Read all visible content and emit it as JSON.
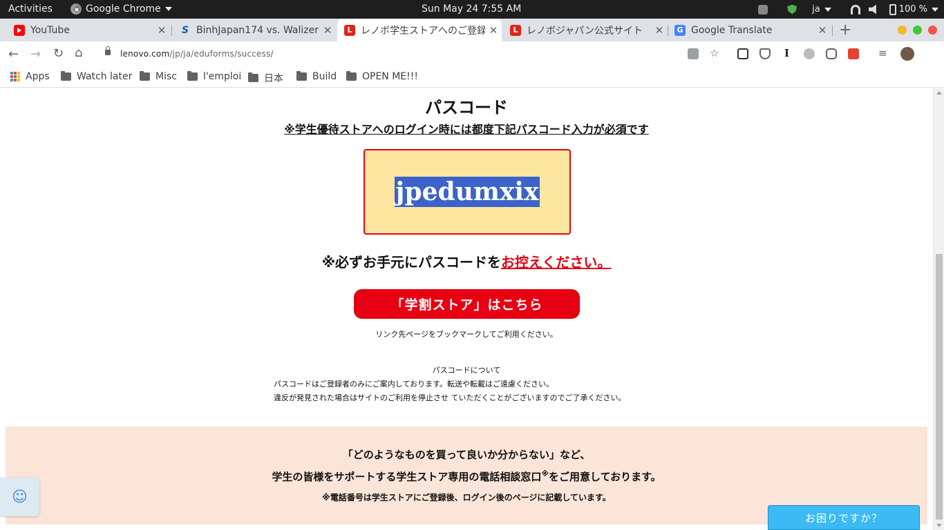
{
  "system": {
    "activities": "Activities",
    "app_name": "Google Chrome",
    "clock": "Sun May 24   7:55 AM",
    "input_method": "ja",
    "battery": "100 %"
  },
  "tabs": [
    {
      "title": "YouTube",
      "icon": "youtube-icon"
    },
    {
      "title": "BinhJapan174 vs. Walizer",
      "icon": "s-icon"
    },
    {
      "title": "レノボ学生ストアへのご登録",
      "icon": "lenovo-icon",
      "active": true
    },
    {
      "title": "レノボジャパン公式サイト",
      "icon": "lenovo-icon"
    },
    {
      "title": "Google Translate",
      "icon": "google-translate-icon"
    }
  ],
  "address": {
    "host": "lenovo.com",
    "path": "/jp/ja/eduforms/success/"
  },
  "bookmarks": [
    {
      "label": "Apps",
      "icon": "apps-grid-icon"
    },
    {
      "label": "Watch later",
      "icon": "folder-icon"
    },
    {
      "label": "Misc",
      "icon": "folder-icon"
    },
    {
      "label": "l'emploi",
      "icon": "folder-icon"
    },
    {
      "label": "日本",
      "icon": "folder-icon"
    },
    {
      "label": "Build",
      "icon": "folder-icon"
    },
    {
      "label": "OPEN ME!!!",
      "icon": "folder-icon"
    }
  ],
  "page": {
    "heading": "パスコード",
    "sub_note": "※学生優待ストアへのログイン時には都度下記パスコード入力が必須です",
    "passcode": "jpedumxix",
    "keep_note_black": "※必ずお手元にパスコードを",
    "keep_note_red": "お控えください。",
    "store_button": "「学割ストア」はこちら",
    "bookmark_note": "リンク先ページをブックマークしてご利用ください。",
    "about_title": "パスコードについて",
    "about_line1": "パスコードはご登録者のみにご案内しております。転送や転載はご遠慮ください。",
    "about_line2": "違反が発見された場合はサイトのご利用を停止させ ていただくことがございますのでご了承ください。"
  },
  "support": {
    "line1": "「どのようなものを買って良いか分からない」など、",
    "line2_pre": "学生の皆様をサポートする学生ストア専用の電話相談窓口",
    "line2_mark": "※",
    "line2_post": "をご用意しております。",
    "line3": "※電話番号は学生ストアにご登録後、ログイン後のページに記載しています。"
  },
  "help_button": "お困りですか？",
  "colors": {
    "accent_red": "#e60012",
    "passcode_bg": "#fde6a0",
    "support_bg": "#fbe4d8",
    "help_blue": "#3bbaf3"
  }
}
